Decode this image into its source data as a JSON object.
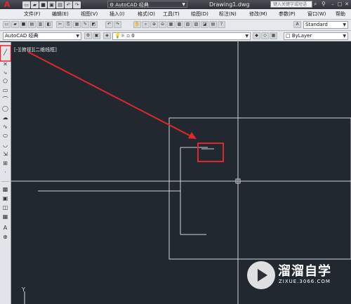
{
  "colors": {
    "annotation_red": "#e0262e",
    "canvas_bg": "#212830",
    "line": "#d0d3d6"
  },
  "titlebar": {
    "workspace": "AutoCAD 经典",
    "document_title": "Drawing1.dwg",
    "search_placeholder": "键入关键字或短语",
    "icons": [
      "app-logo-icon",
      "new-icon",
      "open-icon",
      "save-icon",
      "save-as-icon",
      "print-icon",
      "undo-icon",
      "redo-icon"
    ]
  },
  "menubar": {
    "items": [
      "文件(F)",
      "编辑(E)",
      "视图(V)",
      "插入(I)",
      "格式(O)",
      "工具(T)",
      "绘图(D)",
      "标注(N)",
      "修改(M)",
      "参数(P)",
      "窗口(W)",
      "帮助"
    ]
  },
  "toolbar1": {
    "text_style": "Standard"
  },
  "toolbar2": {
    "workspace": "AutoCAD 经典",
    "layer": "0",
    "color": "ByLayer"
  },
  "viewport": {
    "label": "[-][俯视][二维线框]",
    "ucs_y": "Y"
  },
  "watermark": {
    "title": "溜溜自学",
    "url": "ZIXUE.3066.COM"
  }
}
